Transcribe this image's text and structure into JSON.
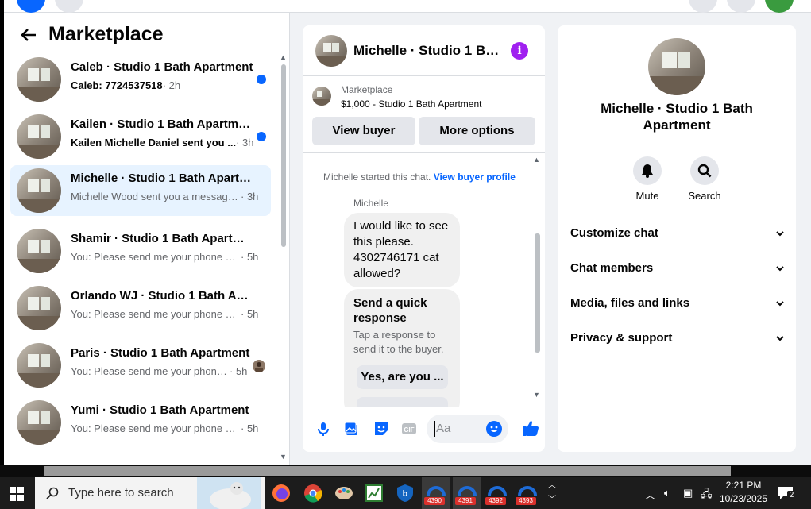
{
  "marketplace": {
    "title": "Marketplace"
  },
  "conversations": [
    {
      "title": "Caleb · Studio 1 Bath Apartment",
      "message": "Caleb: 7724537518",
      "time": "2h",
      "unread": true
    },
    {
      "title": "Kailen · Studio 1 Bath Apartment",
      "message": "Kailen Michelle Daniel sent you ...",
      "time": "3h",
      "unread": true
    },
    {
      "title": "Michelle · Studio 1 Bath Apartm...",
      "message": "Michelle Wood sent you a message...",
      "time": "3h",
      "selected": true
    },
    {
      "title": "Shamir · Studio 1 Bath Apartment",
      "message": "You: Please send me your phone nu...",
      "time": "5h"
    },
    {
      "title": "Orlando WJ · Studio 1 Bath Apar...",
      "message": "You: Please send me your phone nu...",
      "time": "5h"
    },
    {
      "title": "Paris · Studio 1 Bath Apartment",
      "message": "You: Please send me your phone...",
      "time": "5h",
      "seen_avatar": true
    },
    {
      "title": "Yumi · Studio 1 Bath Apartment",
      "message": "You: Please send me your phone nu...",
      "time": "5h"
    }
  ],
  "chat": {
    "title": "Michelle · Studio 1 Ba...",
    "listing_label": "Marketplace",
    "listing_price": "$1,000 - Studio 1 Bath Apartment",
    "view_buyer": "View buyer",
    "more_options": "More options",
    "system_text": "Michelle started this chat.",
    "system_link": "View buyer profile",
    "sender": "Michelle",
    "message": "I would like to see this please. 4302746171 cat allowed?",
    "quick_title": "Send a quick response",
    "quick_sub": "Tap a response to send it to the buyer.",
    "quick_reply_1": "Yes, are you ...",
    "input_placeholder": "Aa"
  },
  "details": {
    "name": "Michelle · Studio 1 Bath Apartment",
    "mute": "Mute",
    "search": "Search",
    "sections": [
      "Customize chat",
      "Chat members",
      "Media, files and links",
      "Privacy & support"
    ]
  },
  "taskbar": {
    "search_placeholder": "Type here to search",
    "badges": [
      "4390",
      "4391",
      "4392",
      "4393"
    ],
    "time": "2:21 PM",
    "date": "10/23/2025",
    "notifications": "2"
  },
  "colors": {
    "accent": "#0866ff",
    "purple": "#a020f0",
    "selected_row": "#e7f3ff"
  }
}
